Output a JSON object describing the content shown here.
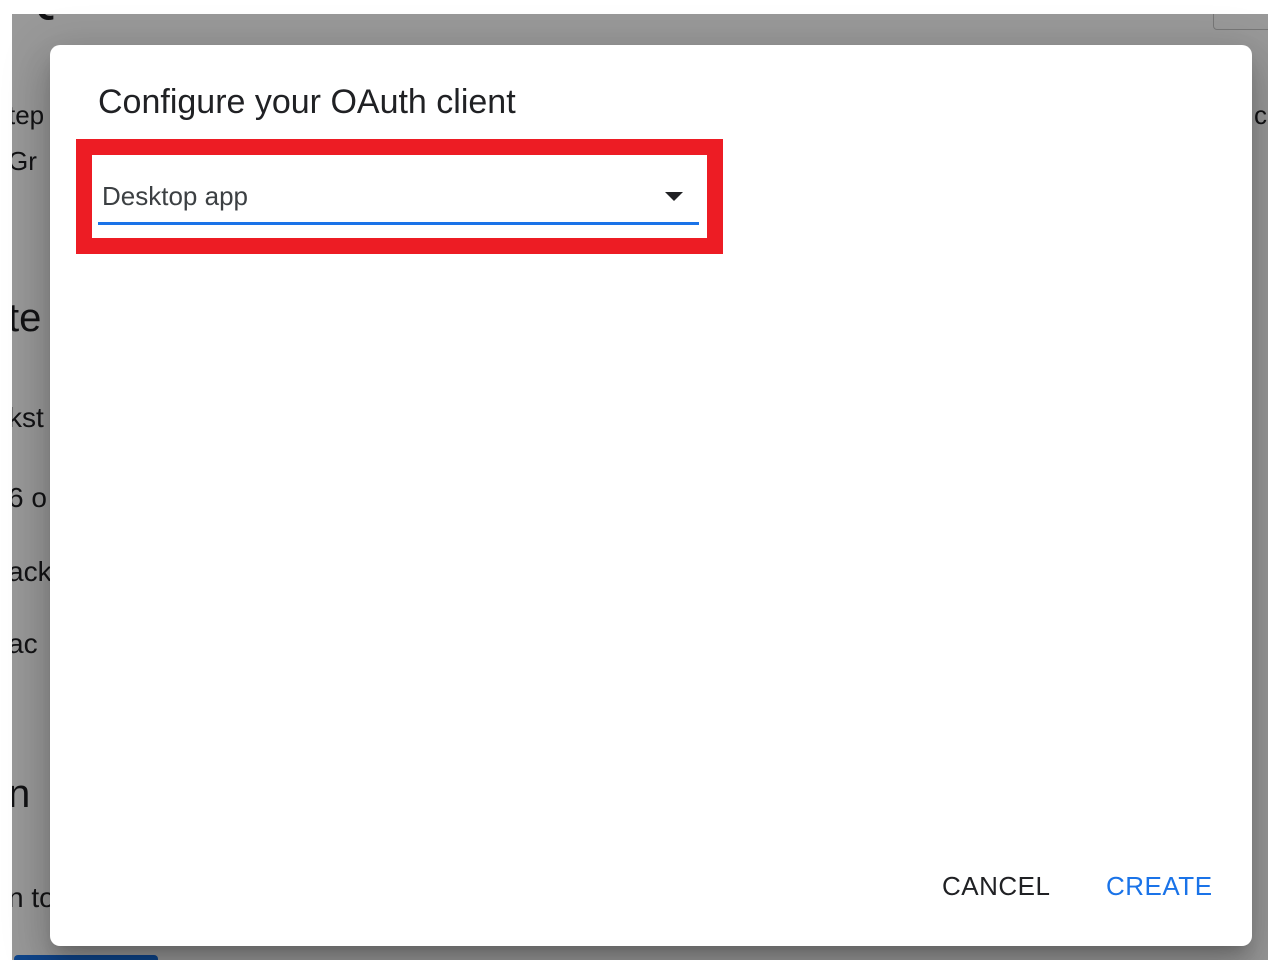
{
  "background_page": {
    "title_fragment": "Quickstart",
    "fragments": [
      "tep",
      "Gr",
      "te",
      "kst",
      "6 o",
      "ack",
      "ac",
      "n",
      "n to"
    ],
    "right_fragment": "c"
  },
  "dialog": {
    "title": "Configure your OAuth client",
    "application_type_select": {
      "selected_value": "Desktop app"
    },
    "actions": {
      "cancel_label": "CANCEL",
      "create_label": "CREATE"
    }
  },
  "colors": {
    "highlight_border": "#ed1c24",
    "accent": "#1a73e8",
    "scrim": "rgba(0,0,0,0.4)"
  },
  "icons": {
    "select_arrow": "dropdown-arrow-icon"
  }
}
